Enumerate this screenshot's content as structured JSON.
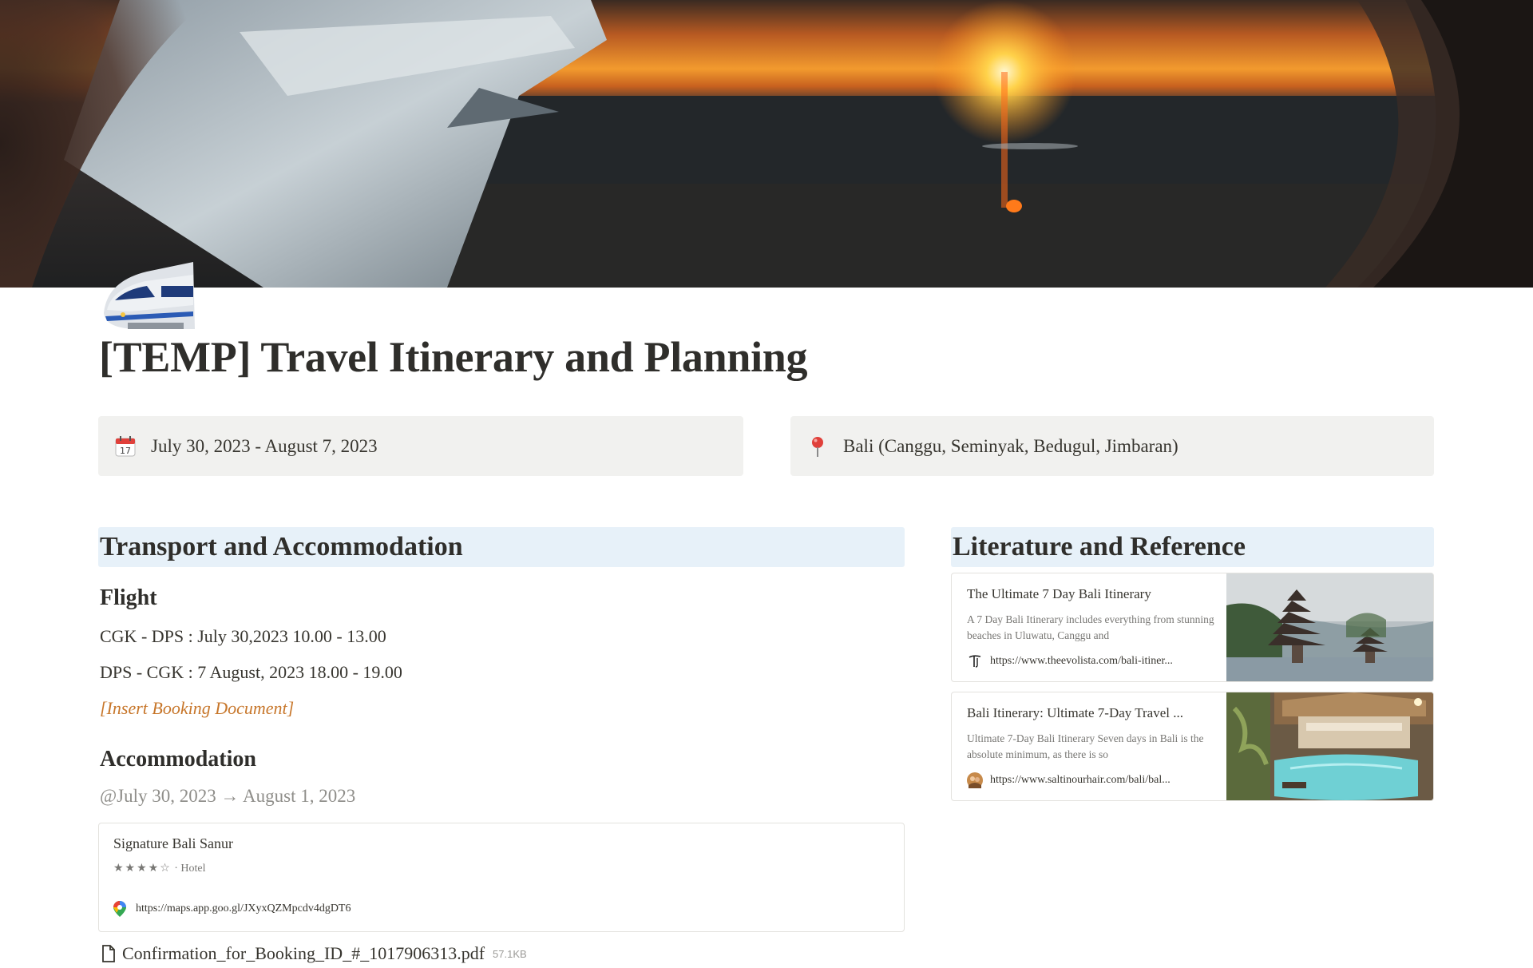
{
  "cover": {
    "alt": "airplane-window-sunset-cover"
  },
  "page": {
    "icon": "bullet-train-icon",
    "title": "[TEMP] Travel Itinerary and Planning"
  },
  "callouts": {
    "dates": {
      "icon": "calendar-icon",
      "text": "July 30, 2023 - August 7, 2023"
    },
    "location": {
      "icon": "round-pushpin-icon",
      "text": "Bali (Canggu, Seminyak, Bedugul, Jimbaran)"
    }
  },
  "transport": {
    "heading": "Transport and Accommodation",
    "flight_heading": "Flight",
    "flight_lines": [
      "CGK - DPS :  July 30,2023 10.00 - 13.00",
      "DPS - CGK : 7 August, 2023  18.00 - 19.00"
    ],
    "booking_placeholder": "[Insert Booking Document]",
    "accommodation_heading": "Accommodation",
    "accommodation_dates": "@July 30, 2023 → August 1, 2023",
    "place": {
      "name": "Signature Bali Sanur",
      "stars": "★★★★☆",
      "type": "· Hotel",
      "url": "https://maps.app.goo.gl/JXyxQZMpcdv4dgDT6"
    },
    "file": {
      "name": "Confirmation_for_Booking_ID_#_1017906313.pdf",
      "size": "57.1KB"
    }
  },
  "literature": {
    "heading": "Literature and Reference",
    "bookmarks": [
      {
        "title": "The Ultimate 7 Day Bali Itinerary",
        "description": "A 7 Day Bali Itinerary includes everything from stunning beaches in Uluwatu, Canggu and",
        "url": "https://www.theevolista.com/bali-itiner...",
        "favicon": "theevolista-logo-icon"
      },
      {
        "title": "Bali Itinerary: Ultimate 7-Day Travel ...",
        "description": "Ultimate 7-Day Bali Itinerary Seven days in Bali is the absolute minimum, as there is so",
        "url": "https://www.saltinourhair.com/bali/bal...",
        "favicon": "saltinourhair-avatar-icon"
      }
    ]
  }
}
